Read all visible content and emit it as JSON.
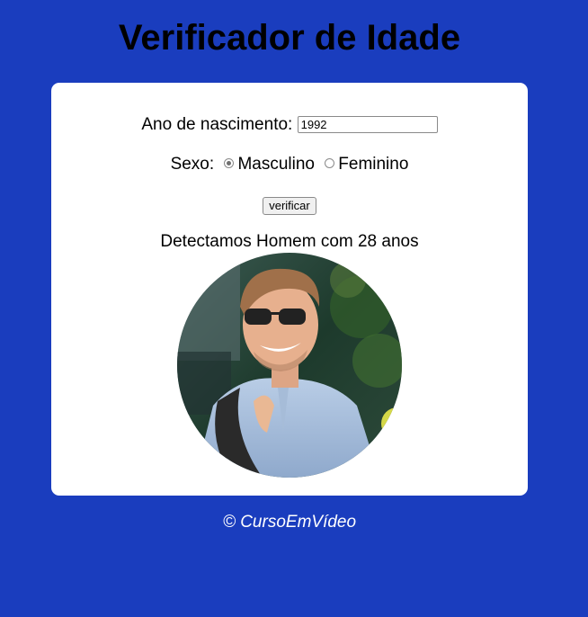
{
  "title": "Verificador de Idade",
  "form": {
    "year_label": "Ano de nascimento:",
    "year_value": "1992",
    "sex_label": "Sexo:",
    "male_label": "Masculino",
    "female_label": "Feminino",
    "selected_sex": "Masculino",
    "submit_label": "verificar"
  },
  "result": {
    "text": "Detectamos Homem com 28 anos",
    "photo_icon": "man-photo"
  },
  "footer": {
    "text": "© CursoEmVídeo"
  },
  "colors": {
    "background": "#1a3dbe",
    "card": "#ffffff",
    "footer_text": "#ffffff"
  }
}
